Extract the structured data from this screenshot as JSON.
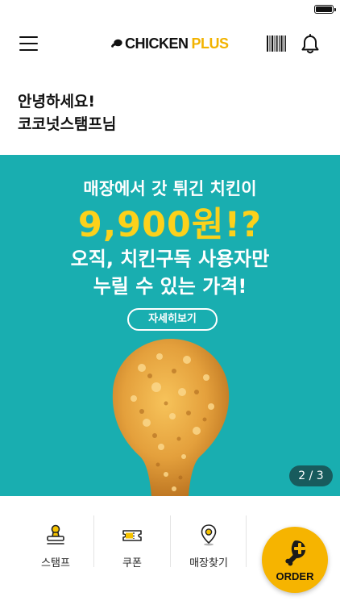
{
  "header": {
    "logo_word1": "CHICKEN",
    "logo_word2": "PLUS",
    "menu_icon": "hamburger-icon",
    "barcode_icon": "barcode-icon",
    "bell_icon": "bell-icon"
  },
  "greeting": {
    "line1": "안녕하세요!",
    "line2": "코코넛스탬프님"
  },
  "banner": {
    "line1": "매장에서 갓 튀긴 치킨이",
    "price": "9,900원!?",
    "line3": "오직, 치킨구독 사용자만",
    "line4": "누릴 수 있는 가격!",
    "detail_button": "자세히보기",
    "pager": "2 / 3",
    "background_color": "#19aeb0",
    "price_color": "#fcd11b"
  },
  "quick_menu": [
    {
      "label": "스탬프",
      "icon": "stamp-icon"
    },
    {
      "label": "쿠폰",
      "icon": "coupon-icon"
    },
    {
      "label": "매장찾기",
      "icon": "location-pin-icon"
    }
  ],
  "order_button": {
    "label": "ORDER",
    "icon": "drumstick-plus-icon",
    "color": "#f6b400"
  },
  "colors": {
    "brand_yellow": "#f2b300",
    "banner_teal": "#19aeb0"
  }
}
